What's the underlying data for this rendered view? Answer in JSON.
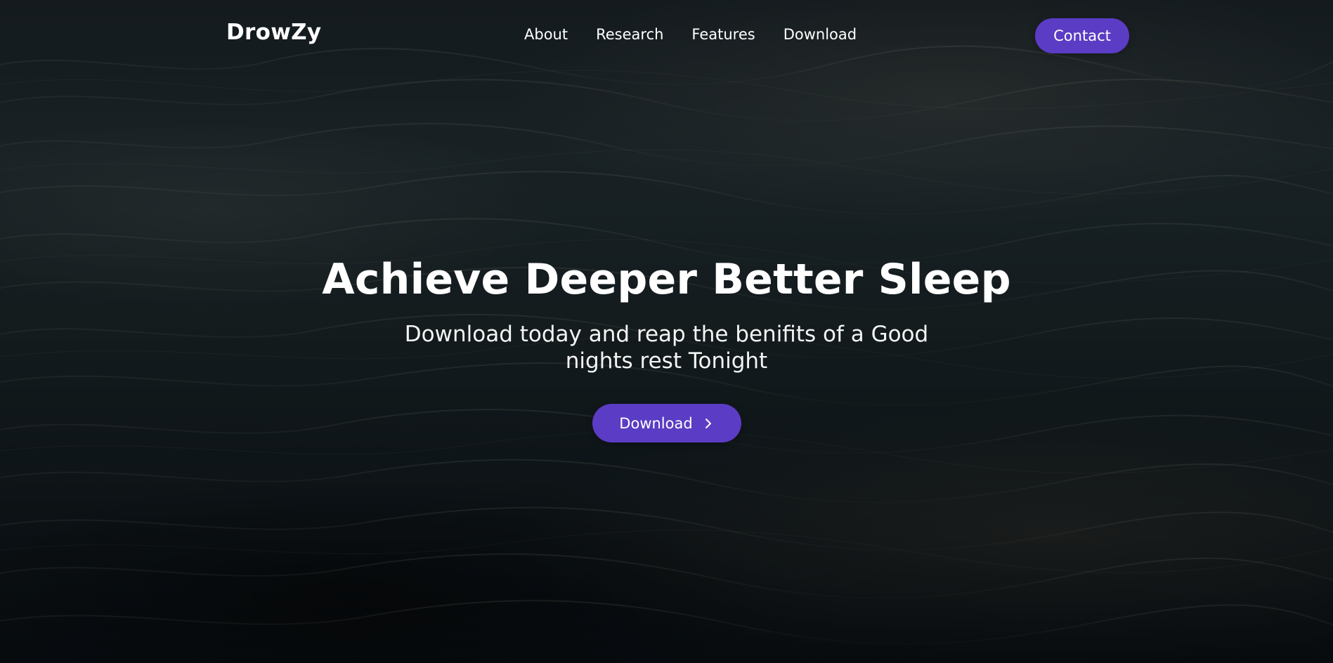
{
  "brand": {
    "name": "DrowZy"
  },
  "nav": {
    "items": [
      {
        "label": "About"
      },
      {
        "label": "Research"
      },
      {
        "label": "Features"
      },
      {
        "label": "Download"
      }
    ],
    "contact_label": "Contact"
  },
  "hero": {
    "title": "Achieve Deeper Better Sleep",
    "subtitle": "Download today and reap the benifits of a Good nights rest Tonight",
    "cta_label": "Download",
    "cta_icon": "chevron-right-icon"
  },
  "theme": {
    "accent": "#5b3cc4",
    "text": "#ffffff"
  }
}
